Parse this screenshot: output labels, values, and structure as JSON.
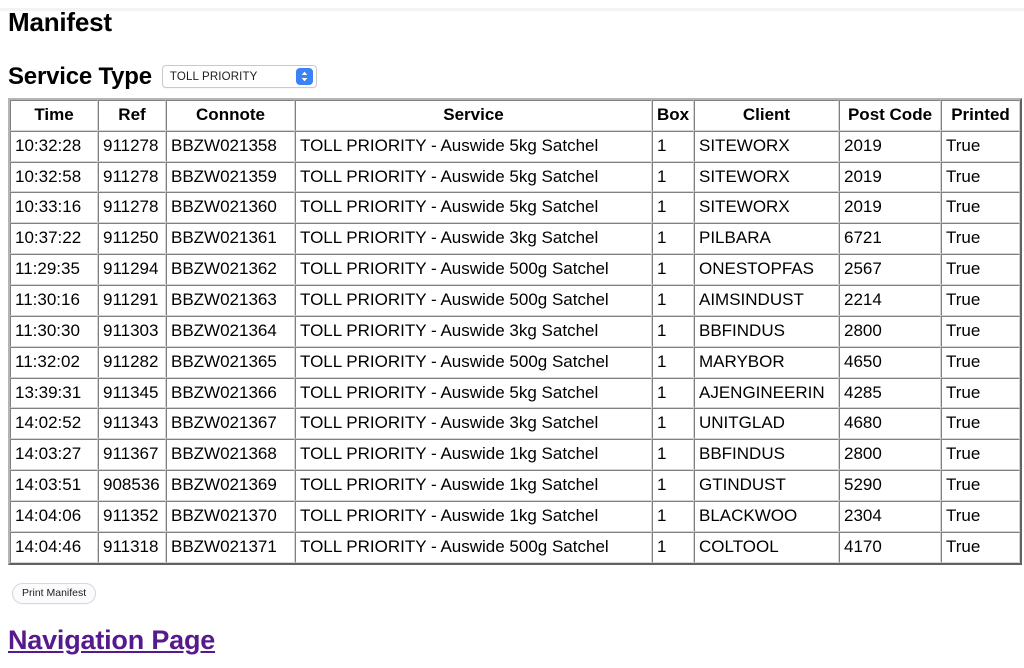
{
  "page": {
    "title": "Manifest"
  },
  "service_type": {
    "label": "Service Type",
    "selected": "TOLL PRIORITY",
    "stepper_icon": "chevron-up-down-icon"
  },
  "table": {
    "columns": [
      "Time",
      "Ref",
      "Connote",
      "Service",
      "Box",
      "Client",
      "Post Code",
      "Printed"
    ],
    "rows": [
      {
        "time": "10:32:28",
        "ref": "911278",
        "connote": "BBZW021358",
        "service": "TOLL PRIORITY - Auswide 5kg Satchel",
        "box": "1",
        "client": "SITEWORX",
        "post_code": "2019",
        "printed": "True"
      },
      {
        "time": "10:32:58",
        "ref": "911278",
        "connote": "BBZW021359",
        "service": "TOLL PRIORITY - Auswide 5kg Satchel",
        "box": "1",
        "client": "SITEWORX",
        "post_code": "2019",
        "printed": "True"
      },
      {
        "time": "10:33:16",
        "ref": "911278",
        "connote": "BBZW021360",
        "service": "TOLL PRIORITY - Auswide 5kg Satchel",
        "box": "1",
        "client": "SITEWORX",
        "post_code": "2019",
        "printed": "True"
      },
      {
        "time": "10:37:22",
        "ref": "911250",
        "connote": "BBZW021361",
        "service": "TOLL PRIORITY - Auswide 3kg Satchel",
        "box": "1",
        "client": "PILBARA",
        "post_code": "6721",
        "printed": "True"
      },
      {
        "time": "11:29:35",
        "ref": "911294",
        "connote": "BBZW021362",
        "service": "TOLL PRIORITY - Auswide 500g Satchel",
        "box": "1",
        "client": "ONESTOPFAS",
        "post_code": "2567",
        "printed": "True"
      },
      {
        "time": "11:30:16",
        "ref": "911291",
        "connote": "BBZW021363",
        "service": "TOLL PRIORITY - Auswide 500g Satchel",
        "box": "1",
        "client": "AIMSINDUST",
        "post_code": "2214",
        "printed": "True"
      },
      {
        "time": "11:30:30",
        "ref": "911303",
        "connote": "BBZW021364",
        "service": "TOLL PRIORITY - Auswide 3kg Satchel",
        "box": "1",
        "client": "BBFINDUS",
        "post_code": "2800",
        "printed": "True"
      },
      {
        "time": "11:32:02",
        "ref": "911282",
        "connote": "BBZW021365",
        "service": "TOLL PRIORITY - Auswide 500g Satchel",
        "box": "1",
        "client": "MARYBOR",
        "post_code": "4650",
        "printed": "True"
      },
      {
        "time": "13:39:31",
        "ref": "911345",
        "connote": "BBZW021366",
        "service": "TOLL PRIORITY - Auswide 5kg Satchel",
        "box": "1",
        "client": "AJENGINEERIN",
        "post_code": "4285",
        "printed": "True"
      },
      {
        "time": "14:02:52",
        "ref": "911343",
        "connote": "BBZW021367",
        "service": "TOLL PRIORITY - Auswide 3kg Satchel",
        "box": "1",
        "client": "UNITGLAD",
        "post_code": "4680",
        "printed": "True"
      },
      {
        "time": "14:03:27",
        "ref": "911367",
        "connote": "BBZW021368",
        "service": "TOLL PRIORITY - Auswide 1kg Satchel",
        "box": "1",
        "client": "BBFINDUS",
        "post_code": "2800",
        "printed": "True"
      },
      {
        "time": "14:03:51",
        "ref": "908536",
        "connote": "BBZW021369",
        "service": "TOLL PRIORITY - Auswide 1kg Satchel",
        "box": "1",
        "client": "GTINDUST",
        "post_code": "5290",
        "printed": "True"
      },
      {
        "time": "14:04:06",
        "ref": "911352",
        "connote": "BBZW021370",
        "service": "TOLL PRIORITY - Auswide 1kg Satchel",
        "box": "1",
        "client": "BLACKWOO",
        "post_code": "2304",
        "printed": "True"
      },
      {
        "time": "14:04:46",
        "ref": "911318",
        "connote": "BBZW021371",
        "service": "TOLL PRIORITY - Auswide 500g Satchel",
        "box": "1",
        "client": "COLTOOL",
        "post_code": "4170",
        "printed": "True"
      }
    ]
  },
  "actions": {
    "print_manifest_label": "Print Manifest"
  },
  "footer": {
    "nav_link_label": "Navigation Page",
    "nav_link_color": "#551a8b"
  }
}
